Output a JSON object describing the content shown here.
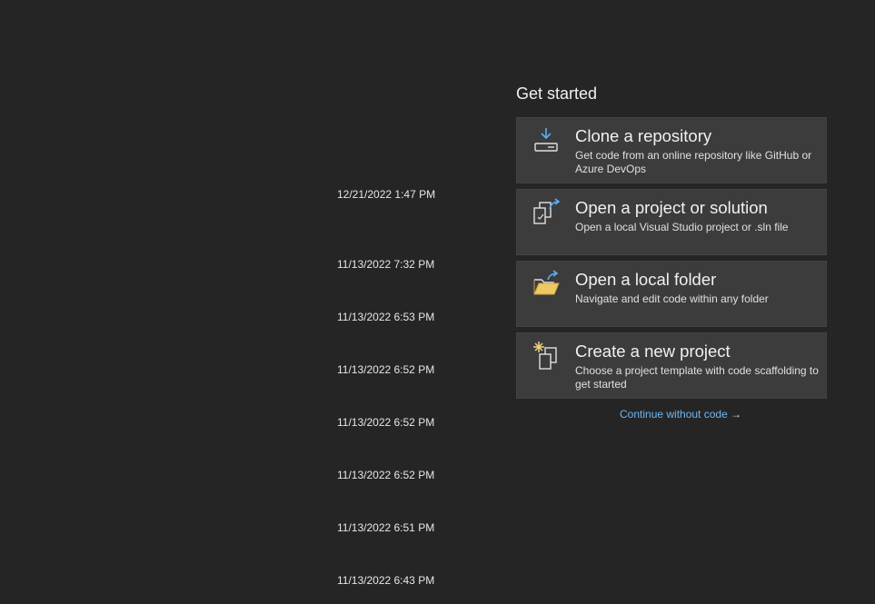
{
  "recent": {
    "timestamps": [
      "12/21/2022 1:47 PM",
      "11/13/2022 7:32 PM",
      "11/13/2022 6:53 PM",
      "11/13/2022 6:52 PM",
      "11/13/2022 6:52 PM",
      "11/13/2022 6:52 PM",
      "11/13/2022 6:51 PM",
      "11/13/2022 6:43 PM"
    ]
  },
  "get_started": {
    "heading": "Get started",
    "cards": [
      {
        "title": "Clone a repository",
        "description": "Get code from an online repository like GitHub or Azure DevOps",
        "icon": "clone-repository-icon"
      },
      {
        "title": "Open a project or solution",
        "description": "Open a local Visual Studio project or .sln file",
        "icon": "open-project-icon"
      },
      {
        "title": "Open a local folder",
        "description": "Navigate and edit code within any folder",
        "icon": "open-folder-icon"
      },
      {
        "title": "Create a new project",
        "description": "Choose a project template with code scaffolding to get started",
        "icon": "new-project-icon"
      }
    ],
    "continue_label": "Continue without code",
    "continue_arrow": "→"
  },
  "colors": {
    "background": "#252526",
    "card_background": "#3c3c3c",
    "card_border": "#434346",
    "link": "#6fb6f0",
    "icon_accent": "#5aaef5",
    "folder_accent": "#f0c862"
  }
}
